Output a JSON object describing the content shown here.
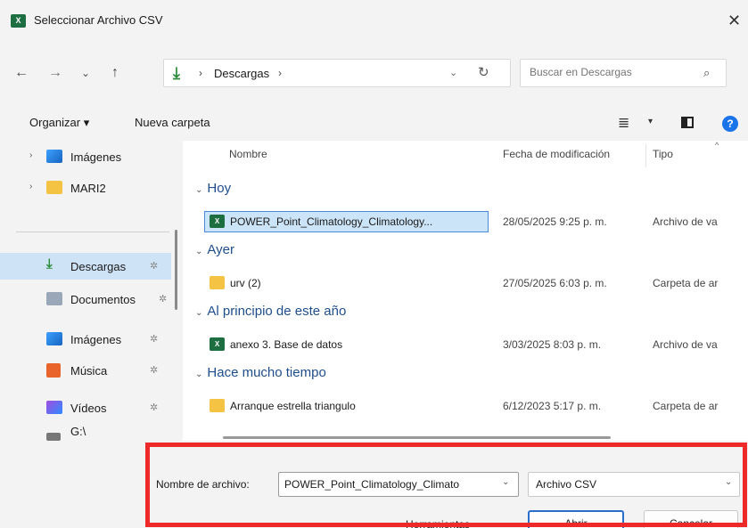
{
  "window": {
    "title": "Seleccionar Archivo CSV",
    "app_icon": "X",
    "close_symbol": "✕"
  },
  "nav": {
    "back_symbol": "←",
    "forward_symbol": "→",
    "recent_symbol": "⌄",
    "up_symbol": "↑",
    "address": {
      "separator": "›",
      "location": "Descargas",
      "dropdown_symbol": "⌄",
      "refresh_symbol": "↻"
    },
    "search": {
      "placeholder": "Buscar en Descargas",
      "icon": "search-icon"
    }
  },
  "commands": {
    "organize": "Organizar ▾",
    "new_folder": "Nueva carpeta",
    "view_symbol": "≣",
    "view_dropdown": "▾",
    "help": "?"
  },
  "sidebar": {
    "items": [
      {
        "label": "Imágenes",
        "icon": "images-icon",
        "expand": "›"
      },
      {
        "label": "MARI2",
        "icon": "folder-icon",
        "expand": "›"
      },
      {
        "label": "Descargas",
        "icon": "download-icon",
        "pin": "✲"
      },
      {
        "label": "Documentos",
        "icon": "documents-icon",
        "pin": "✲"
      },
      {
        "label": "Imágenes",
        "icon": "images-icon",
        "pin": "✲"
      },
      {
        "label": "Música",
        "icon": "music-icon",
        "pin": "✲"
      },
      {
        "label": "Vídeos",
        "icon": "videos-icon",
        "pin": "✲"
      },
      {
        "label": "G:\\",
        "icon": "drive-icon"
      }
    ]
  },
  "filelist": {
    "columns": {
      "name": "Nombre",
      "date": "Fecha de modificación",
      "type": "Tipo",
      "sort_symbol": "^"
    },
    "groups": [
      {
        "label": "Hoy",
        "chevron": "⌄"
      },
      {
        "label": "Ayer",
        "chevron": "⌄"
      },
      {
        "label": "Al principio de este año",
        "chevron": "⌄"
      },
      {
        "label": "Hace mucho tiempo",
        "chevron": "⌄"
      }
    ],
    "rows": [
      {
        "name": "POWER_Point_Climatology_Climatology...",
        "date": "28/05/2025 9:25 p. m.",
        "type": "Archivo de va",
        "icon": "xl"
      },
      {
        "name": "urv (2)",
        "date": "27/05/2025 6:03 p. m.",
        "type": "Carpeta de ar",
        "icon": "fold"
      },
      {
        "name": "anexo 3. Base de datos",
        "date": "3/03/2025 8:03 p. m.",
        "type": "Archivo de va",
        "icon": "xl"
      },
      {
        "name": "Arranque estrella triangulo",
        "date": "6/12/2023 5:17 p. m.",
        "type": "Carpeta de ar",
        "icon": "fold"
      }
    ]
  },
  "footer": {
    "filename_label": "Nombre de archivo:",
    "filename_value": "POWER_Point_Climatology_Climato",
    "filetype_value": "Archivo CSV",
    "dropdown_symbol": "⌄",
    "tools": "Herramientas",
    "tools_dropdown": "▾",
    "open": "Abrir",
    "cancel": "Cancelar"
  },
  "colors": {
    "accent": "#1a73e8",
    "selection": "#cce4f7",
    "highlight": "#ee2929",
    "excel": "#1d6f42",
    "folder": "#f5c343"
  }
}
